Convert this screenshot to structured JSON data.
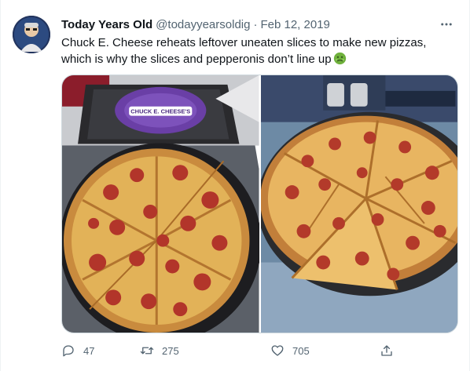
{
  "tweet": {
    "author_name": "Today Years Old",
    "author_handle": "@todayyearsoldig",
    "separator": "·",
    "date": "Feb 12, 2019",
    "text": "Chuck E. Cheese reheats leftover uneaten slices to make new pizzas, which is why the slices and pepperonis don’t line up",
    "emoji": "nauseated-face-emoji",
    "tray_plate_text": "CHUCK E. CHEESE'S"
  },
  "actions": {
    "replies": "47",
    "retweets": "275",
    "likes": "705"
  },
  "icons": {
    "more": "more-horizontal-icon",
    "reply": "reply-icon",
    "retweet": "retweet-icon",
    "like": "heart-icon",
    "share": "share-icon"
  },
  "colors": {
    "text_primary": "#0f1419",
    "text_secondary": "#536471",
    "border": "#cfd9de"
  }
}
